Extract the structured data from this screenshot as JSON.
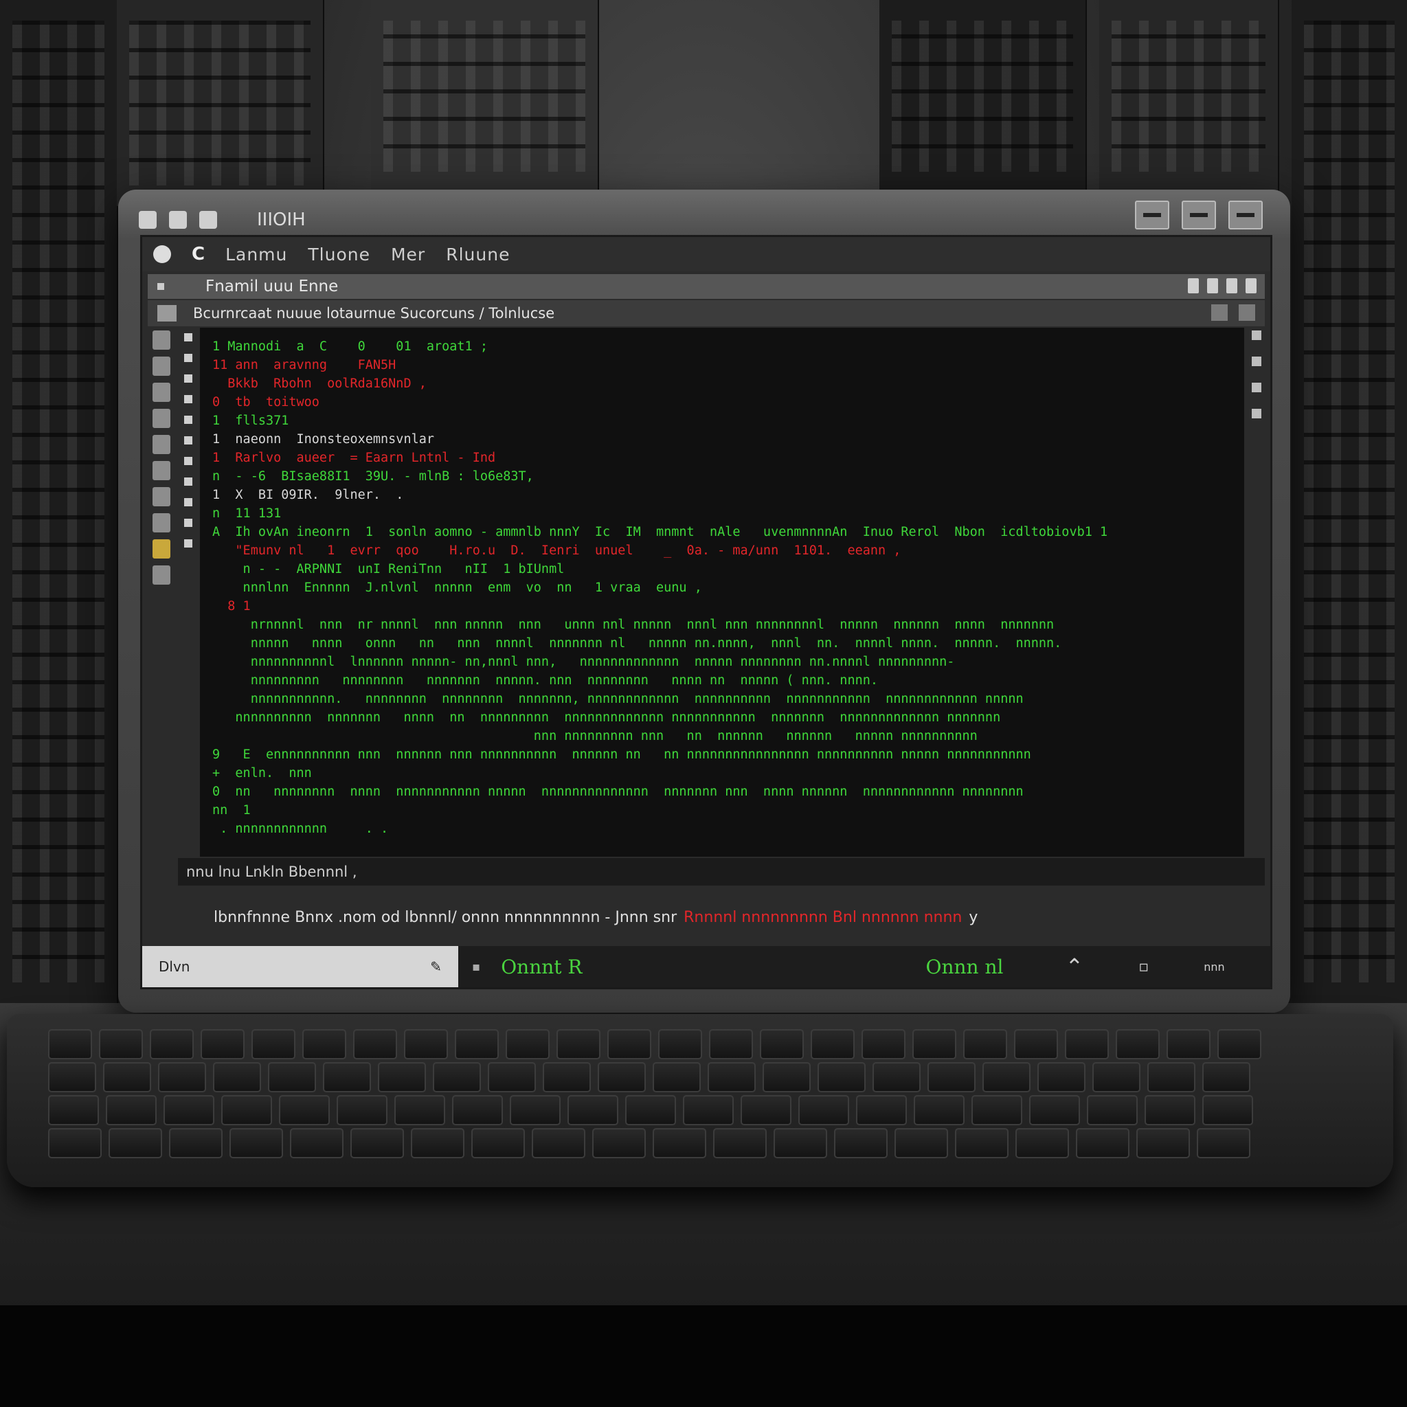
{
  "window": {
    "title": "IIIOIH"
  },
  "menu": {
    "back_label": "C",
    "items": [
      "Lanmu",
      "Tluone",
      "Mer",
      "Rluune"
    ]
  },
  "tab": {
    "title": "Fnamil uuu Enne"
  },
  "path": {
    "text": "Bcurnrcaat nuuue lotaurnue  Sucorcuns / Tolnlucse"
  },
  "terminal": {
    "lines": [
      {
        "text": "1 Mannodi  a  C    0    01  aroat1 ;",
        "color": "green"
      },
      {
        "text": "11 ann  aravnng    FAN5H",
        "color": "red"
      },
      {
        "text": "  Bkkb  Rbohn  oolRda16NnD ,",
        "color": "red"
      },
      {
        "text": "0  tb  toitwoo",
        "color": "red"
      },
      {
        "text": "1  flls371",
        "color": "green"
      },
      {
        "text": "1  naeonn  Inonsteoxemnsvnlar",
        "color": "white"
      },
      {
        "text": "1  Rarlvo  aueer  = Eaarn Lntnl - Ind",
        "color": "red"
      },
      {
        "text": "n  - -6  BIsae88I1  39U. - mlnB : lo6e83T,",
        "color": "green"
      },
      {
        "text": "1  X  BI 09IR.  9lner.  .",
        "color": "white"
      },
      {
        "text": "n  11 131",
        "color": "green"
      },
      {
        "text": "A  Ih ovAn ineonrn  1  sonln aomno - ammnlb nnnY  Ic  IM  mnmnt  nAle   uvenmnnnnAn  Inuo Rerol  Nbon  icdltobiovb1 1",
        "color": "green"
      },
      {
        "text": "   \"Emunv nl   1  evrr  qoo    H.ro.u  D.  Ienri  unuel    _  0a. - ma/unn  1101.  eeann ,",
        "color": "red"
      },
      {
        "text": "    n - -  ARPNNI  unI ReniTnn   nII  1 bIUnml",
        "color": "green"
      },
      {
        "text": "    nnnlnn  Ennnnn  J.nlvnl  nnnnn  enm  vo  nn   1 vraa  eunu ,",
        "color": "green"
      },
      {
        "text": "",
        "color": "green"
      },
      {
        "text": "  8 1",
        "color": "red"
      },
      {
        "text": "     nrnnnnl  nnn  nr nnnnl  nnn nnnnn  nnn   unnn nnl nnnnn  nnnl nnn nnnnnnnnl  nnnnn  nnnnnn  nnnn  nnnnnnn",
        "color": "green"
      },
      {
        "text": "     nnnnn   nnnn   onnn   nn   nnn  nnnnl  nnnnnnn nl   nnnnn nn.nnnn,  nnnl  nn.  nnnnl nnnn.  nnnnn.  nnnnn.",
        "color": "green"
      },
      {
        "text": "     nnnnnnnnnnl  lnnnnnn nnnnn- nn,nnnl nnn,   nnnnnnnnnnnnn  nnnnn nnnnnnnn nn.nnnnl nnnnnnnnn-",
        "color": "green"
      },
      {
        "text": "     nnnnnnnnn   nnnnnnnn   nnnnnnn  nnnnn. nnn  nnnnnnnn   nnnn nn  nnnnn ( nnn. nnnn.",
        "color": "green"
      },
      {
        "text": "     nnnnnnnnnnn.   nnnnnnnn  nnnnnnnn  nnnnnnn, nnnnnnnnnnnn  nnnnnnnnnn  nnnnnnnnnnn  nnnnnnnnnnnn nnnnn",
        "color": "green"
      },
      {
        "text": "   nnnnnnnnnn  nnnnnnn   nnnn  nn  nnnnnnnnn  nnnnnnnnnnnnn nnnnnnnnnnn  nnnnnnn  nnnnnnnnnnnnn nnnnnnn",
        "color": "green"
      },
      {
        "text": "                                          nnn nnnnnnnnn nnn   nn  nnnnnn   nnnnnn   nnnnn nnnnnnnnnn",
        "color": "green"
      },
      {
        "text": "9   E  ennnnnnnnnn nnn  nnnnnn nnn nnnnnnnnnn  nnnnnn nn   nn nnnnnnnnnnnnnnnn nnnnnnnnnn nnnnn nnnnnnnnnnn",
        "color": "green"
      },
      {
        "text": "+  enln.  nnn",
        "color": "green"
      },
      {
        "text": "0  nn   nnnnnnnn  nnnn  nnnnnnnnnnn nnnnn  nnnnnnnnnnnnnn  nnnnnnn nnn  nnnn nnnnnn  nnnnnnnnnnnn nnnnnnnn",
        "color": "green"
      },
      {
        "text": "nn  1",
        "color": "green"
      },
      {
        "text": " . nnnnnnnnnnnn     . .",
        "color": "green"
      }
    ]
  },
  "status": {
    "text": "nnu  lnu  Lnkln  Bbennnl ,"
  },
  "info": {
    "text": "lbnnfnnne  Bnnx .nom  od  lbnnnl/   onnn  nnnnnnnnnn  - Jnnn  snr",
    "red_text": "Rnnnnl  nnnnnnnnn    Bnl nnnnnn nnnn",
    "tail": "y"
  },
  "bottom": {
    "search_value": "Dlvn",
    "left_label": "Onnnt  R",
    "right_label": "Onnn  nl",
    "end_label": "nnn"
  },
  "colors": {
    "terminal_green": "#3fd73a",
    "terminal_red": "#e2262a",
    "terminal_bg": "#101010"
  }
}
